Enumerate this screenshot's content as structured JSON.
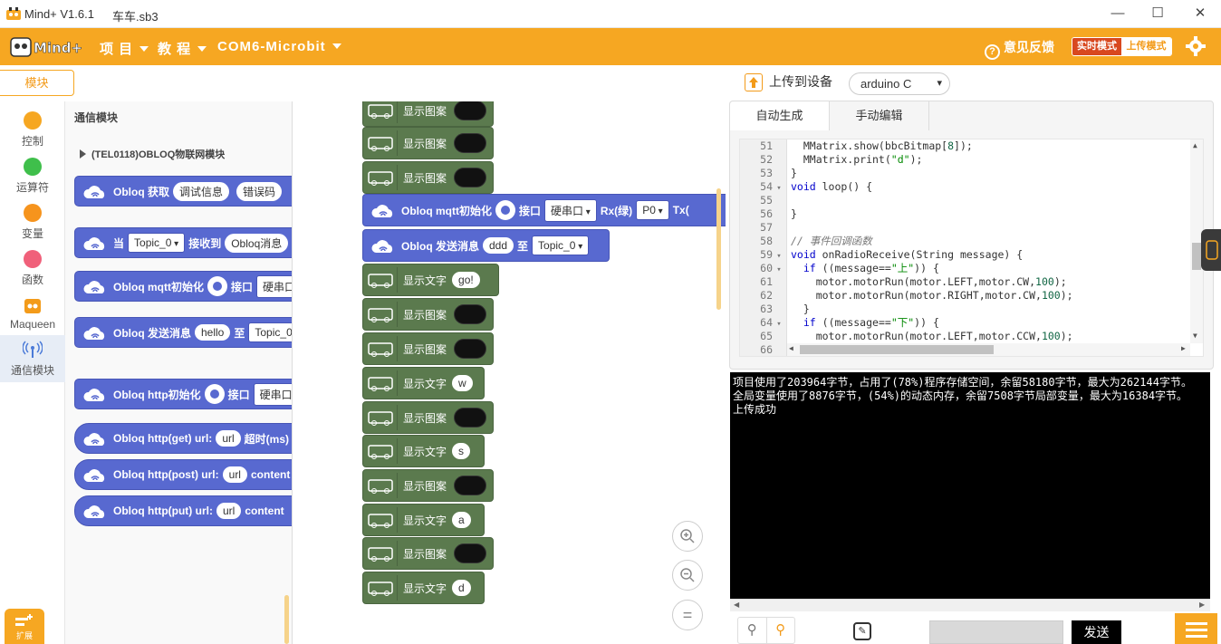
{
  "window": {
    "app_title": "Mind+ V1.6.1",
    "file_name": "车车.sb3"
  },
  "menubar": {
    "items": [
      {
        "label": "项 目"
      },
      {
        "label": "教 程"
      },
      {
        "label": "COM6-Microbit"
      }
    ],
    "feedback": "意见反馈",
    "mode_realtime": "实时模式",
    "mode_upload": "上传模式",
    "brand_color": "#f6a722"
  },
  "sidebar": {
    "modules_tab": "模块",
    "categories": [
      {
        "label": "控制",
        "color": "#f6a722"
      },
      {
        "label": "运算符",
        "color": "#3fbf4b"
      },
      {
        "label": "变量",
        "color": "#f6941d"
      },
      {
        "label": "函数",
        "color": "#f0607a"
      },
      {
        "label": "Maqueen",
        "color": "#f39b1a"
      },
      {
        "label": "通信模块",
        "color": "#4a7ad8"
      }
    ],
    "extension": "扩展"
  },
  "flyout": {
    "title": "通信模块",
    "subtitle": "(TEL0118)OBLOQ物联网模块",
    "blocks": [
      {
        "parts": [
          "Obloq 获取",
          "调试信息",
          "错误码"
        ]
      },
      {
        "parts": [
          "当",
          "Topic_0",
          "接收到",
          "Obloq消息"
        ]
      },
      {
        "parts": [
          "Obloq mqtt初始化",
          "接口",
          "硬串口"
        ]
      },
      {
        "parts": [
          "Obloq 发送消息",
          "hello",
          "至",
          "Topic_0"
        ]
      },
      {
        "parts": [
          "Obloq http初始化",
          "接口",
          "硬串口"
        ]
      },
      {
        "parts": [
          "Obloq http(get) url:",
          "url",
          "超时(ms)"
        ]
      },
      {
        "parts": [
          "Obloq http(post) url:",
          "url",
          "content"
        ]
      },
      {
        "parts": [
          "Obloq http(put) url:",
          "url",
          "content"
        ]
      }
    ]
  },
  "workspace": {
    "show_pattern": "显示图案",
    "show_text": "显示文字",
    "mqtt": {
      "label": "Obloq mqtt初始化",
      "iface": "接口",
      "port": "硬串口",
      "rx": "Rx(绿)",
      "pin": "P0",
      "tx": "Tx("
    },
    "send": {
      "label": "Obloq 发送消息",
      "msg": "ddd",
      "to": "至",
      "topic": "Topic_0"
    },
    "texts": [
      "go!",
      "w",
      "s",
      "a",
      "d"
    ],
    "zoom_reset": "="
  },
  "right": {
    "upload_to_device": "上传到设备",
    "board": "arduino C",
    "tab_auto": "自动生成",
    "tab_manual": "手动编辑",
    "code_lines": [
      {
        "n": "51",
        "fold": "",
        "text": "  MMatrix.show(bbcBitmap[8]);"
      },
      {
        "n": "52",
        "fold": "",
        "text": "  MMatrix.print(\"d\");"
      },
      {
        "n": "53",
        "fold": "",
        "text": "}"
      },
      {
        "n": "54",
        "fold": "▾",
        "text": "void loop() {"
      },
      {
        "n": "55",
        "fold": "",
        "text": ""
      },
      {
        "n": "56",
        "fold": "",
        "text": "}"
      },
      {
        "n": "57",
        "fold": "",
        "text": ""
      },
      {
        "n": "58",
        "fold": "",
        "text": "// 事件回调函数"
      },
      {
        "n": "59",
        "fold": "▾",
        "text": "void onRadioReceive(String message) {"
      },
      {
        "n": "60",
        "fold": "▾",
        "text": "  if ((message==\"上\")) {"
      },
      {
        "n": "61",
        "fold": "",
        "text": "    motor.motorRun(motor.LEFT,motor.CW,100);"
      },
      {
        "n": "62",
        "fold": "",
        "text": "    motor.motorRun(motor.RIGHT,motor.CW,100);"
      },
      {
        "n": "63",
        "fold": "",
        "text": "  }"
      },
      {
        "n": "64",
        "fold": "▾",
        "text": "  if ((message==\"下\")) {"
      },
      {
        "n": "65",
        "fold": "",
        "text": "    motor.motorRun(motor.LEFT,motor.CCW,100);"
      },
      {
        "n": "66",
        "fold": "",
        "text": ""
      }
    ],
    "console_lines": [
      "项目使用了203964字节，占用了(78%)程序存储空间，余留58180字节，最大为262144字节。",
      "全局变量使用了8876字节，(54%)的动态内存，余留7508字节局部变量，最大为16384字节。",
      "上传成功"
    ],
    "send_button": "发送"
  }
}
